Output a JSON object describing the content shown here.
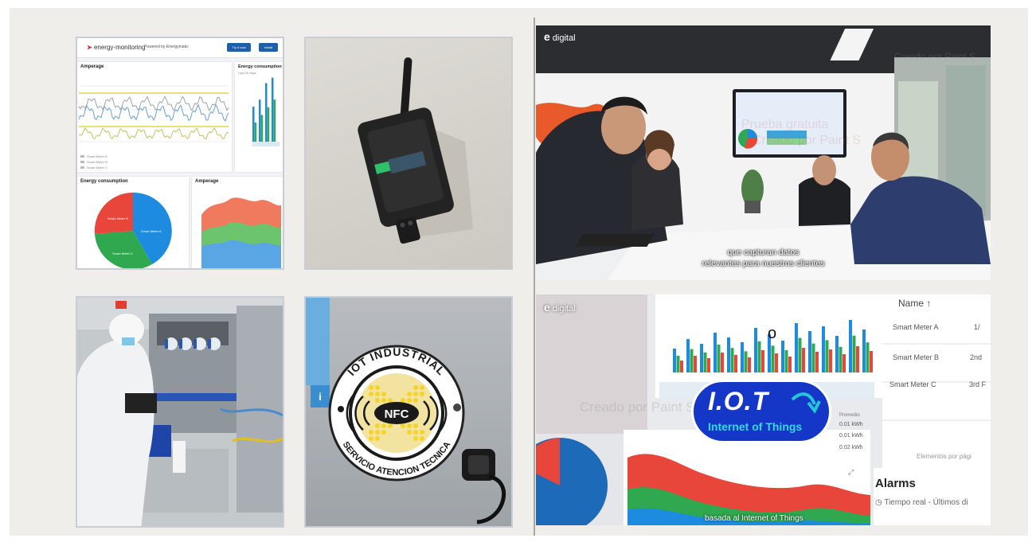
{
  "dashboard": {
    "app_name": "energy-monitoring",
    "subtitle": "Powered by Energymatic",
    "button_primary": "Try it now",
    "button_secondary": "Install",
    "line_card_title": "Amperage",
    "energy_card_title": "Energy consumption",
    "energy_card_subtitle": "Last 30 days",
    "pie_card_title": "Energy consumption",
    "area_card_title": "Amperage",
    "pie_labels": [
      "Smart Meter A",
      "Smart Meter B",
      "Smart Meter C"
    ],
    "legend_rows": [
      "Smart Meter A",
      "Smart Meter B",
      "Smart Meter C"
    ]
  },
  "meeting": {
    "logo": "e",
    "logo_word": "digital",
    "subtitle_line1": "que capturan datos",
    "subtitle_line2": "relevantes para nuestros clientes",
    "watermark_line1": "Prueba gratuita",
    "watermark_line2": "Creado por Paint S",
    "watermark_corner": "Creado por Paint S"
  },
  "nfc": {
    "ring_top": "IOT INDUSTRIAL",
    "ring_bottom": "SERVICIO ATENCION TECNICA",
    "center": "NFC",
    "info_icon": "i"
  },
  "iot": {
    "logo": "e",
    "logo_word": "digital",
    "badge_title": "I.O.T",
    "badge_subtitle": "Internet of Things",
    "cursor_glyph": "o",
    "table_header": "Name ↑",
    "meters": [
      "Smart Meter A",
      "Smart Meter B",
      "Smart Meter C"
    ],
    "meter_values": [
      "1/",
      "2nd",
      "3rd F"
    ],
    "promedio_label": "Promedio",
    "kwh_values": [
      "0.01 kWh",
      "0.01 kWh",
      "0.02 kWh"
    ],
    "pager_text": "Elementos por pági",
    "alarms_title": "Alarms",
    "alarms_sub": "Tiempo real - Últimos di",
    "bottom_caption": "basada al Internet of Things",
    "watermark": "Creado por Paint S"
  },
  "colors": {
    "red": "#e8463a",
    "blue": "#1c8be0",
    "green": "#2fa84f",
    "badge_blue": "#1437c8"
  }
}
